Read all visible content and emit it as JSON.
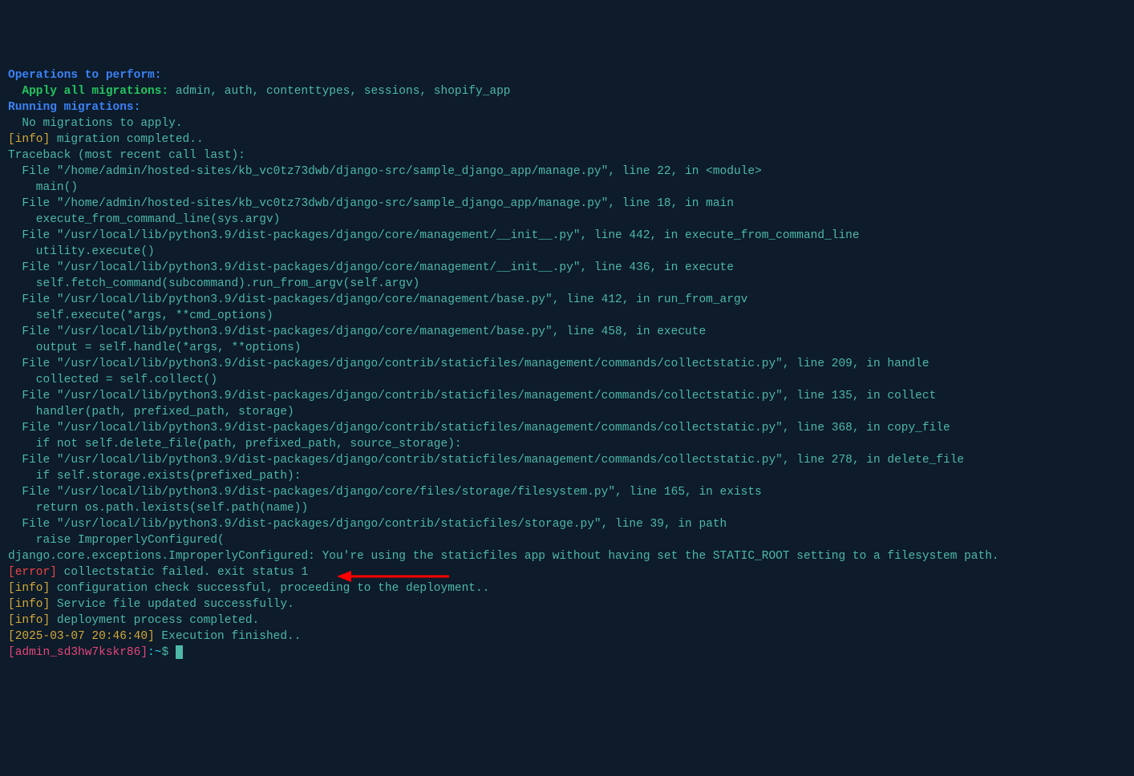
{
  "lines": {
    "op_perform": "Operations to perform:",
    "apply_all_prefix": "  Apply all migrations: ",
    "apply_all_list": "admin, auth, contenttypes, sessions, shopify_app",
    "running_mig": "Running migrations:",
    "no_mig": "  No migrations to apply.",
    "info_tag": "[info]",
    "error_tag": "[error]",
    "mig_completed": " migration completed..",
    "tb_header": "Traceback (most recent call last):",
    "tb1": "  File \"/home/admin/hosted-sites/kb_vc0tz73dwb/django-src/sample_django_app/manage.py\", line 22, in <module>",
    "tb1b": "    main()",
    "tb2": "  File \"/home/admin/hosted-sites/kb_vc0tz73dwb/django-src/sample_django_app/manage.py\", line 18, in main",
    "tb2b": "    execute_from_command_line(sys.argv)",
    "tb3": "  File \"/usr/local/lib/python3.9/dist-packages/django/core/management/__init__.py\", line 442, in execute_from_command_line",
    "tb3b": "    utility.execute()",
    "tb4": "  File \"/usr/local/lib/python3.9/dist-packages/django/core/management/__init__.py\", line 436, in execute",
    "tb4b": "    self.fetch_command(subcommand).run_from_argv(self.argv)",
    "tb5": "  File \"/usr/local/lib/python3.9/dist-packages/django/core/management/base.py\", line 412, in run_from_argv",
    "tb5b": "    self.execute(*args, **cmd_options)",
    "tb6": "  File \"/usr/local/lib/python3.9/dist-packages/django/core/management/base.py\", line 458, in execute",
    "tb6b": "    output = self.handle(*args, **options)",
    "tb7": "  File \"/usr/local/lib/python3.9/dist-packages/django/contrib/staticfiles/management/commands/collectstatic.py\", line 209, in handle",
    "tb7b": "    collected = self.collect()",
    "tb8": "  File \"/usr/local/lib/python3.9/dist-packages/django/contrib/staticfiles/management/commands/collectstatic.py\", line 135, in collect",
    "tb8b": "    handler(path, prefixed_path, storage)",
    "tb9": "  File \"/usr/local/lib/python3.9/dist-packages/django/contrib/staticfiles/management/commands/collectstatic.py\", line 368, in copy_file",
    "tb9b": "    if not self.delete_file(path, prefixed_path, source_storage):",
    "tb10": "  File \"/usr/local/lib/python3.9/dist-packages/django/contrib/staticfiles/management/commands/collectstatic.py\", line 278, in delete_file",
    "tb10b": "    if self.storage.exists(prefixed_path):",
    "tb11": "  File \"/usr/local/lib/python3.9/dist-packages/django/core/files/storage/filesystem.py\", line 165, in exists",
    "tb11b": "    return os.path.lexists(self.path(name))",
    "tb12": "  File \"/usr/local/lib/python3.9/dist-packages/django/contrib/staticfiles/storage.py\", line 39, in path",
    "tb12b": "    raise ImproperlyConfigured(",
    "exception": "django.core.exceptions.ImproperlyConfigured: You're using the staticfiles app without having set the STATIC_ROOT setting to a filesystem path.",
    "err_collect": " collectstatic failed. exit status 1",
    "info_config": " configuration check successful, proceeding to the deployment..",
    "info_service": " Service file updated successfully.",
    "info_deploy": " deployment process completed.",
    "timestamp": "[2025-03-07 20:46:40]",
    "exec_finished": " Execution finished..",
    "prompt_user": "[admin_sd3hw7kskr86]",
    "prompt_path": ":~",
    "prompt_dollar": "$ "
  }
}
